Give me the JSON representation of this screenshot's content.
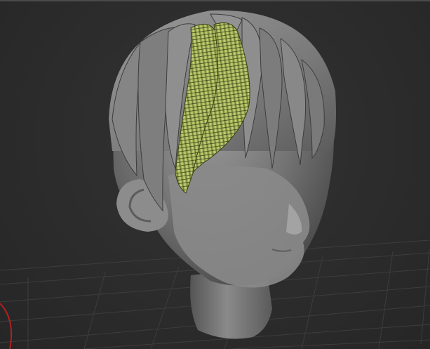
{
  "viewport": {
    "kind": "3d-sculpt-viewport",
    "background": "#2b2b2b",
    "grid_color": "#3e3e3e",
    "axis_color": "#b02020"
  },
  "model": {
    "name": "stylized-head-with-hair",
    "skin_color": "#7a7a7a",
    "hair_color": "#8a8a8a",
    "selected_strand_color": "#b8c86a",
    "selected_wire_color": "#2a2f10"
  },
  "icons": {
    "axis": "axis-indicator-icon"
  }
}
